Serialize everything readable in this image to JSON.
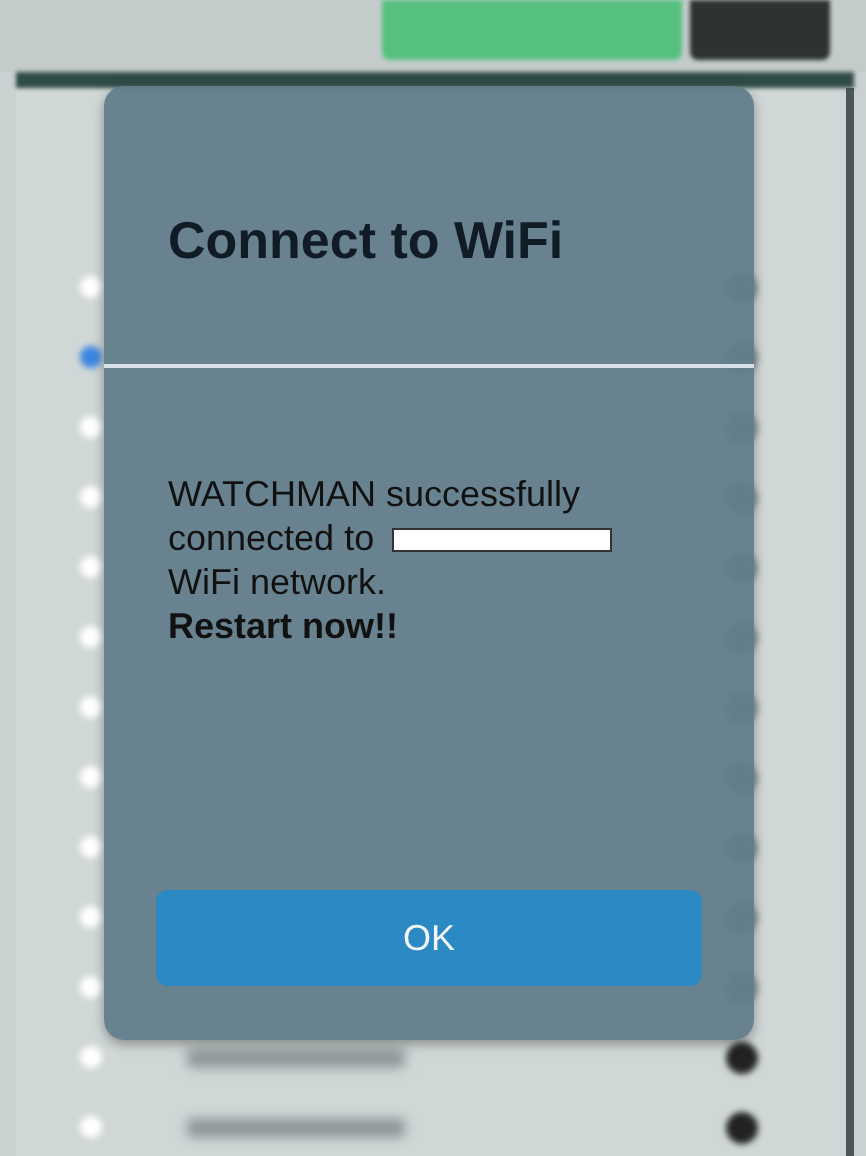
{
  "background_list": {
    "rows": [
      {
        "selected": false,
        "locked": false
      },
      {
        "selected": true,
        "locked": false
      },
      {
        "selected": false,
        "locked": false
      },
      {
        "selected": false,
        "locked": false
      },
      {
        "selected": false,
        "locked": false
      },
      {
        "selected": false,
        "locked": false
      },
      {
        "selected": false,
        "locked": false
      },
      {
        "selected": false,
        "locked": false
      },
      {
        "selected": false,
        "locked": false
      },
      {
        "selected": false,
        "locked": false
      },
      {
        "selected": false,
        "locked": false
      },
      {
        "selected": false,
        "locked": true
      },
      {
        "selected": false,
        "locked": true
      }
    ]
  },
  "dialog": {
    "title": "Connect to WiFi",
    "message_start": "WATCHMAN successfully connected to",
    "network_redacted": true,
    "message_end": "WiFi network.",
    "emphasis": "Restart now!!",
    "button": "OK"
  }
}
